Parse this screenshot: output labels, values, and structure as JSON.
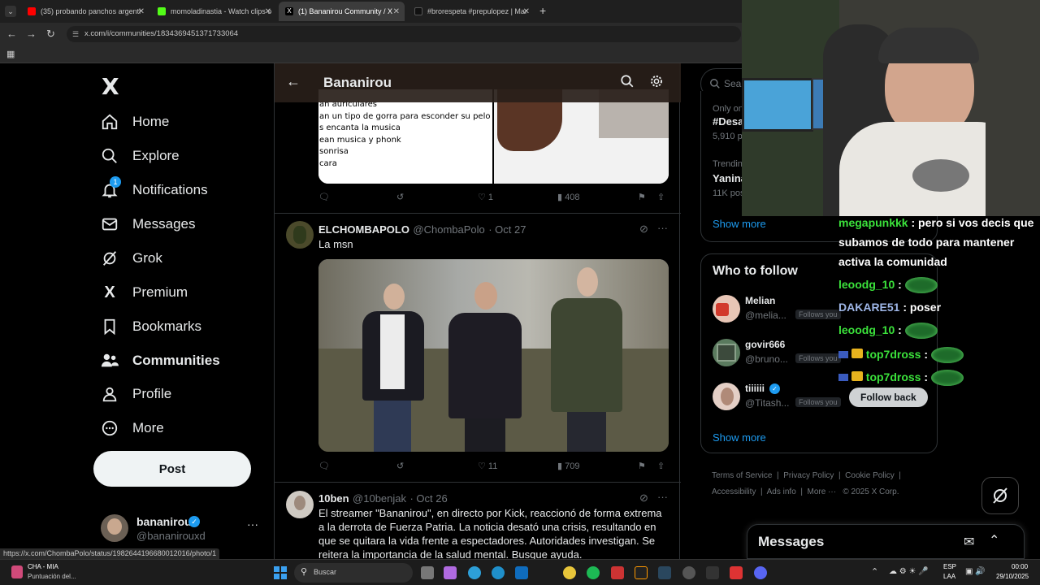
{
  "browser": {
    "tabs": [
      {
        "title": "(35) probando panchos argenti",
        "icon_color": "#ff0000"
      },
      {
        "title": "momoladinastia - Watch clips o",
        "icon_color": "#53fc18"
      },
      {
        "title": "(1) Bananirou Community / X",
        "icon_color": "#ffffff"
      },
      {
        "title": "#brorespeta #prepulopez | Mar",
        "icon_color": "#ffffff"
      }
    ],
    "url": "x.com/i/communities/1834369451371733064",
    "status_url": "https://x.com/ChombaPolo/status/1982644196680012016/photo/1"
  },
  "sidebar": {
    "items": [
      {
        "label": "Home",
        "icon": "home-icon"
      },
      {
        "label": "Explore",
        "icon": "search-icon"
      },
      {
        "label": "Notifications",
        "icon": "bell-icon",
        "badge": "1"
      },
      {
        "label": "Messages",
        "icon": "mail-icon"
      },
      {
        "label": "Grok",
        "icon": "grok-icon"
      },
      {
        "label": "Premium",
        "icon": "x-logo-icon"
      },
      {
        "label": "Bookmarks",
        "icon": "bookmark-icon"
      },
      {
        "label": "Communities",
        "icon": "people-icon"
      },
      {
        "label": "Profile",
        "icon": "person-icon"
      },
      {
        "label": "More",
        "icon": "more-circle-icon"
      }
    ],
    "post_label": "Post",
    "account": {
      "name": "bananirou",
      "handle": "@bananirouxd"
    }
  },
  "feed": {
    "title": "Bananirou",
    "image_text_lines": [
      "an auriculares",
      "an un tipo de gorra para esconder su pelo",
      "s encanta la musica",
      "ean musica y phonk",
      "sonrisa",
      "cara"
    ],
    "tweet0_actions": {
      "replies": "",
      "reposts": "",
      "likes": "1",
      "views": "408"
    },
    "tweet1": {
      "name": "ELCHOMBAPOLO",
      "handle": "@ChombaPolo",
      "date": "Oct 27",
      "text": "La msn",
      "actions": {
        "replies": "",
        "reposts": "",
        "likes": "11",
        "views": "709"
      }
    },
    "tweet2": {
      "name": "10ben",
      "handle": "@10benjak",
      "date": "Oct 26",
      "text": "El streamer \"Bananirou\", en directo por Kick, reaccionó de forma extrema a la derrota de Fuerza Patria. La noticia desató una crisis, resultando en que se quitara la vida frente a espectadores. Autoridades investigan. Se reitera la importancia de la salud mental. Busque ayuda."
    }
  },
  "right": {
    "search_placeholder": "Sear",
    "trends": [
      {
        "context": "Only on",
        "title": "#Desa",
        "count": "5,910 p"
      },
      {
        "context": "Trendin",
        "title": "Yanina",
        "count": "11K pos"
      }
    ],
    "show_more": "Show more",
    "who_to_follow_title": "Who to follow",
    "suggestions": [
      {
        "name": "Melian",
        "handle": "@melia...",
        "follows_you": "Follows you"
      },
      {
        "name": "govir666",
        "handle": "@bruno...",
        "follows_you": "Follows you"
      },
      {
        "name": "tiiiiii",
        "handle": "@Titash...",
        "follows_you": "Follows you",
        "verified": true
      }
    ],
    "follow_back": "Follow back",
    "show_more2": "Show more",
    "footer": [
      "Terms of Service",
      "Privacy Policy",
      "Cookie Policy",
      "Accessibility",
      "Ads info",
      "More ···",
      "© 2025 X Corp."
    ]
  },
  "chat": {
    "lines": [
      {
        "user": "megapunkkk",
        "text": ": pero si vos decis que subamos de todo para mantener activa la comunidad"
      },
      {
        "user": "leoodg_10",
        "text": ":"
      },
      {
        "user": "DAKARE51",
        "text": ": poser"
      },
      {
        "user": "leoodg_10",
        "text": ":"
      },
      {
        "user": "top7dross",
        "text": ":"
      },
      {
        "user": "top7dross",
        "text": ":"
      }
    ]
  },
  "messages_drawer": {
    "title": "Messages"
  },
  "taskbar": {
    "app_name": "CHA - MIA",
    "app_sub": "Puntuación del...",
    "search_label": "Buscar",
    "lang": "ESP",
    "lang_sub": "LAA",
    "time": "00:00",
    "date": "29/10/2025"
  },
  "colors": {
    "accent": "#1d9bf0",
    "chat_user": "#3be23b"
  }
}
